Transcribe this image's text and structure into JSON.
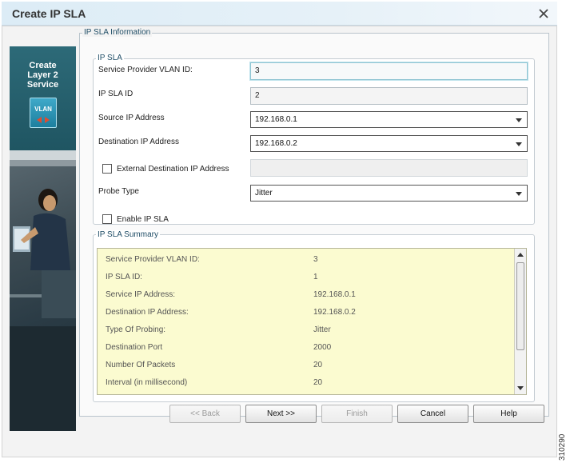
{
  "window": {
    "title": "Create IP SLA"
  },
  "wizard": {
    "heading": "Create\nLayer 2\nService",
    "badge_label": "VLAN"
  },
  "ip_sla_information": {
    "legend": "IP SLA Information",
    "ip_sla_group": {
      "legend": "IP SLA",
      "service_provider_vlan_id": {
        "label": "Service Provider VLAN ID:",
        "value": "3"
      },
      "ip_sla_id": {
        "label": "IP SLA ID",
        "value": "2"
      },
      "source_ip": {
        "label": "Source IP Address",
        "value": "192.168.0.1"
      },
      "destination_ip": {
        "label": "Destination IP Address",
        "value": "192.168.0.2"
      },
      "external_destination": {
        "label": "External Destination IP Address",
        "checked": false,
        "value": ""
      },
      "probe_type": {
        "label": "Probe Type",
        "value": "Jitter"
      },
      "enable_ip_sla": {
        "label": "Enable IP SLA",
        "checked": false
      }
    },
    "summary": {
      "legend": "IP SLA Summary",
      "rows": [
        {
          "key": "Service Provider VLAN ID:",
          "value": "3"
        },
        {
          "key": "IP SLA ID:",
          "value": "1"
        },
        {
          "key": "Service IP Address:",
          "value": "192.168.0.1"
        },
        {
          "key": "Destination IP Address:",
          "value": "192.168.0.2"
        },
        {
          "key": "Type Of Probing:",
          "value": "Jitter"
        },
        {
          "key": "Destination Port",
          "value": "2000"
        },
        {
          "key": "Number Of Packets",
          "value": "20"
        },
        {
          "key": "Interval (in millisecond)",
          "value": "20"
        }
      ]
    }
  },
  "buttons": {
    "back": "<< Back",
    "next": "Next >>",
    "finish": "Finish",
    "cancel": "Cancel",
    "help": "Help"
  },
  "figure_code": "310290",
  "colors": {
    "summary_bg": "#fbfbd0",
    "wizard_panel": "#2d6a78",
    "title_bar": "#dcecf6"
  }
}
